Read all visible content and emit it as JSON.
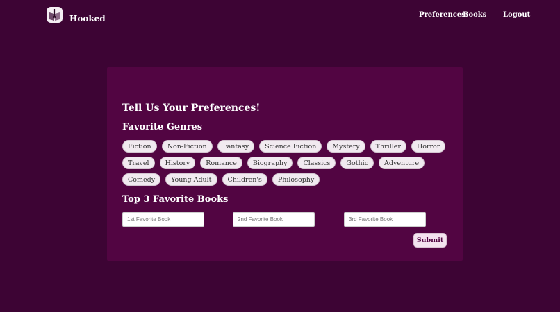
{
  "nav": {
    "brand": "Hooked",
    "links": [
      "Preferences",
      "Books",
      "Logout"
    ]
  },
  "form": {
    "title": "Tell Us Your Preferences!",
    "genres_heading": "Favorite Genres",
    "genres": [
      "Fiction",
      "Non-Fiction",
      "Fantasy",
      "Science Fiction",
      "Mystery",
      "Thriller",
      "Horror",
      "Travel",
      "History",
      "Romance",
      "Biography",
      "Classics",
      "Gothic",
      "Adventure",
      "Comedy",
      "Young Adult",
      "Children's",
      "Philosophy"
    ],
    "books_heading": "Top 3 Favorite Books",
    "book_placeholders": [
      "1st Favorite Book",
      "2nd Favorite Book",
      "3rd Favorite Book"
    ],
    "submit_label": "Submit"
  },
  "colors": {
    "background": "#3d0434",
    "card": "#520542",
    "chip": "#f1eaf0"
  }
}
